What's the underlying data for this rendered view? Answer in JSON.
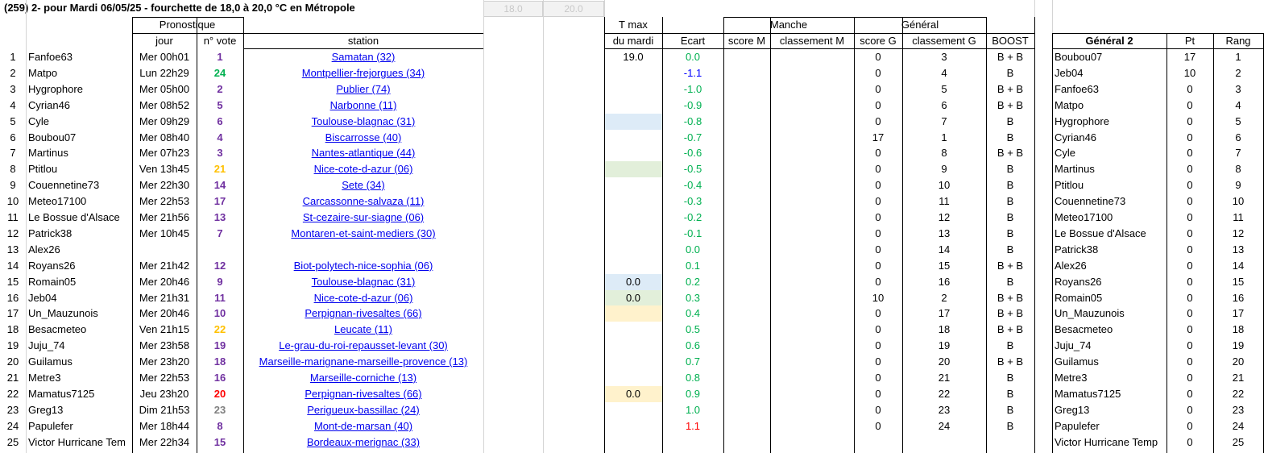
{
  "title": "(259) 2- pour Mardi 06/05/25 - fourchette de 18,0 à 20,0 °C en Métropole",
  "steppers": [
    "18.0",
    "20.0"
  ],
  "headers": {
    "pronostique": "Pronostique",
    "jour": "jour",
    "nvote": "n° vote",
    "station": "station",
    "tmax1": "T max",
    "tmax2": "du mardi",
    "ecart": "Ecart",
    "manche": "Manche",
    "scoreM": "score M",
    "classementM": "classement M",
    "general": "Général",
    "scoreG": "score G",
    "classementG": "classement G",
    "boost": "BOOST",
    "general2": "Général 2",
    "pt": "Pt",
    "rang": "Rang"
  },
  "colors": {
    "vote_purple": "#7030a0",
    "vote_green": "#00b050",
    "vote_orange": "#ffc000",
    "vote_red": "#ff0000",
    "vote_gray": "#808080",
    "ecart_green": "#00b050",
    "ecart_blue": "#0000ff",
    "ecart_red": "#ff0000",
    "fill_blue": "#ddebf7",
    "fill_green": "#e2efda",
    "fill_orange": "#fff2cc"
  },
  "rows": [
    {
      "n": "1",
      "name": "Fanfoe63",
      "jour": "Mer 00h01",
      "vote": "1",
      "vc": "vote_purple",
      "station": "Samatan (32)",
      "tmax": "19.0",
      "fill": "",
      "ecart": "0.0",
      "ec": "ecart_green",
      "scoreG": "0",
      "classG": "3",
      "boost": "B + B",
      "g2": "Boubou07",
      "pt": "17",
      "rang": "1"
    },
    {
      "n": "2",
      "name": "Matpo",
      "jour": "Lun 22h29",
      "vote": "24",
      "vc": "vote_green",
      "station": "Montpellier-frejorgues (34)",
      "tmax": "",
      "fill": "",
      "ecart": "-1.1",
      "ec": "ecart_blue",
      "scoreG": "0",
      "classG": "4",
      "boost": "B",
      "g2": "Jeb04",
      "pt": "10",
      "rang": "2"
    },
    {
      "n": "3",
      "name": "Hygrophore",
      "jour": "Mer 05h00",
      "vote": "2",
      "vc": "vote_purple",
      "station": "Publier (74)",
      "tmax": "",
      "fill": "",
      "ecart": "-1.0",
      "ec": "ecart_green",
      "scoreG": "0",
      "classG": "5",
      "boost": "B + B",
      "g2": "Fanfoe63",
      "pt": "0",
      "rang": "3"
    },
    {
      "n": "4",
      "name": "Cyrian46",
      "jour": "Mer 08h52",
      "vote": "5",
      "vc": "vote_purple",
      "station": "Narbonne (11)",
      "tmax": "",
      "fill": "",
      "ecart": "-0.9",
      "ec": "ecart_green",
      "scoreG": "0",
      "classG": "6",
      "boost": "B + B",
      "g2": "Matpo",
      "pt": "0",
      "rang": "4"
    },
    {
      "n": "5",
      "name": "Cyle",
      "jour": "Mer 09h29",
      "vote": "6",
      "vc": "vote_purple",
      "station": "Toulouse-blagnac (31)",
      "tmax": "",
      "fill": "fill_blue",
      "ecart": "-0.8",
      "ec": "ecart_green",
      "scoreG": "0",
      "classG": "7",
      "boost": "B",
      "g2": "Hygrophore",
      "pt": "0",
      "rang": "5"
    },
    {
      "n": "6",
      "name": "Boubou07",
      "jour": "Mer 08h40",
      "vote": "4",
      "vc": "vote_purple",
      "station": "Biscarrosse (40)",
      "tmax": "",
      "fill": "",
      "ecart": "-0.7",
      "ec": "ecart_green",
      "scoreG": "17",
      "classG": "1",
      "boost": "B",
      "g2": "Cyrian46",
      "pt": "0",
      "rang": "6"
    },
    {
      "n": "7",
      "name": "Martinus",
      "jour": "Mer 07h23",
      "vote": "3",
      "vc": "vote_purple",
      "station": "Nantes-atlantique (44)",
      "tmax": "",
      "fill": "",
      "ecart": "-0.6",
      "ec": "ecart_green",
      "scoreG": "0",
      "classG": "8",
      "boost": "B + B",
      "g2": "Cyle",
      "pt": "0",
      "rang": "7"
    },
    {
      "n": "8",
      "name": "Ptitlou",
      "jour": "Ven 13h45",
      "vote": "21",
      "vc": "vote_orange",
      "station": "Nice-cote-d-azur (06)",
      "tmax": "",
      "fill": "fill_green",
      "ecart": "-0.5",
      "ec": "ecart_green",
      "scoreG": "0",
      "classG": "9",
      "boost": "B",
      "g2": "Martinus",
      "pt": "0",
      "rang": "8"
    },
    {
      "n": "9",
      "name": "Couennetine73",
      "jour": "Mer 22h30",
      "vote": "14",
      "vc": "vote_purple",
      "station": "Sete (34)",
      "tmax": "",
      "fill": "",
      "ecart": "-0.4",
      "ec": "ecart_green",
      "scoreG": "0",
      "classG": "10",
      "boost": "B",
      "g2": "Ptitlou",
      "pt": "0",
      "rang": "9"
    },
    {
      "n": "10",
      "name": "Meteo17100",
      "jour": "Mer 22h53",
      "vote": "17",
      "vc": "vote_purple",
      "station": "Carcassonne-salvaza (11)",
      "tmax": "",
      "fill": "",
      "ecart": "-0.3",
      "ec": "ecart_green",
      "scoreG": "0",
      "classG": "11",
      "boost": "B",
      "g2": "Couennetine73",
      "pt": "0",
      "rang": "10"
    },
    {
      "n": "11",
      "name": "Le Bossue d'Alsace",
      "jour": "Mer 21h56",
      "vote": "13",
      "vc": "vote_purple",
      "station": "St-cezaire-sur-siagne (06)",
      "tmax": "",
      "fill": "",
      "ecart": "-0.2",
      "ec": "ecart_green",
      "scoreG": "0",
      "classG": "12",
      "boost": "B",
      "g2": "Meteo17100",
      "pt": "0",
      "rang": "11"
    },
    {
      "n": "12",
      "name": "Patrick38",
      "jour": "Mer 10h45",
      "vote": "7",
      "vc": "vote_purple",
      "station": "Montaren-et-saint-mediers (30)",
      "tmax": "",
      "fill": "",
      "ecart": "-0.1",
      "ec": "ecart_green",
      "scoreG": "0",
      "classG": "13",
      "boost": "B",
      "g2": "Le Bossue d'Alsace",
      "pt": "0",
      "rang": "12"
    },
    {
      "n": "13",
      "name": "Alex26",
      "jour": "",
      "vote": "",
      "vc": "vote_purple",
      "station": "",
      "tmax": "",
      "fill": "",
      "ecart": "0.0",
      "ec": "ecart_green",
      "scoreG": "0",
      "classG": "14",
      "boost": "B",
      "g2": "Patrick38",
      "pt": "0",
      "rang": "13"
    },
    {
      "n": "14",
      "name": "Royans26",
      "jour": "Mer 21h42",
      "vote": "12",
      "vc": "vote_purple",
      "station": "Biot-polytech-nice-sophia (06)",
      "tmax": "",
      "fill": "",
      "ecart": "0.1",
      "ec": "ecart_green",
      "scoreG": "0",
      "classG": "15",
      "boost": "B + B",
      "g2": "Alex26",
      "pt": "0",
      "rang": "14"
    },
    {
      "n": "15",
      "name": "Romain05",
      "jour": "Mer 20h46",
      "vote": "9",
      "vc": "vote_purple",
      "station": "Toulouse-blagnac (31)",
      "tmax": "0.0",
      "fill": "fill_blue",
      "ecart": "0.2",
      "ec": "ecart_green",
      "scoreG": "0",
      "classG": "16",
      "boost": "B",
      "g2": "Royans26",
      "pt": "0",
      "rang": "15"
    },
    {
      "n": "16",
      "name": "Jeb04",
      "jour": "Mer 21h31",
      "vote": "11",
      "vc": "vote_purple",
      "station": "Nice-cote-d-azur (06)",
      "tmax": "0.0",
      "fill": "fill_green",
      "ecart": "0.3",
      "ec": "ecart_green",
      "scoreG": "10",
      "classG": "2",
      "boost": "B + B",
      "g2": "Romain05",
      "pt": "0",
      "rang": "16"
    },
    {
      "n": "17",
      "name": "Un_Mauzunois",
      "jour": "Mer 20h46",
      "vote": "10",
      "vc": "vote_purple",
      "station": "Perpignan-rivesaltes (66)",
      "tmax": "",
      "fill": "fill_orange",
      "ecart": "0.4",
      "ec": "ecart_green",
      "scoreG": "0",
      "classG": "17",
      "boost": "B + B",
      "g2": "Un_Mauzunois",
      "pt": "0",
      "rang": "17"
    },
    {
      "n": "18",
      "name": "Besacmeteo",
      "jour": "Ven 21h15",
      "vote": "22",
      "vc": "vote_orange",
      "station": "Leucate (11)",
      "tmax": "",
      "fill": "",
      "ecart": "0.5",
      "ec": "ecart_green",
      "scoreG": "0",
      "classG": "18",
      "boost": "B + B",
      "g2": "Besacmeteo",
      "pt": "0",
      "rang": "18"
    },
    {
      "n": "19",
      "name": "Juju_74",
      "jour": "Mer 23h58",
      "vote": "19",
      "vc": "vote_purple",
      "station": "Le-grau-du-roi-repausset-levant (30)",
      "tmax": "",
      "fill": "",
      "ecart": "0.6",
      "ec": "ecart_green",
      "scoreG": "0",
      "classG": "19",
      "boost": "B",
      "g2": "Juju_74",
      "pt": "0",
      "rang": "19"
    },
    {
      "n": "20",
      "name": "Guilamus",
      "jour": "Mer 23h20",
      "vote": "18",
      "vc": "vote_purple",
      "station": "Marseille-marignane-marseille-provence (13)",
      "tmax": "",
      "fill": "",
      "ecart": "0.7",
      "ec": "ecart_green",
      "scoreG": "0",
      "classG": "20",
      "boost": "B + B",
      "g2": "Guilamus",
      "pt": "0",
      "rang": "20"
    },
    {
      "n": "21",
      "name": "Metre3",
      "jour": "Mer 22h53",
      "vote": "16",
      "vc": "vote_purple",
      "station": "Marseille-corniche (13)",
      "tmax": "",
      "fill": "",
      "ecart": "0.8",
      "ec": "ecart_green",
      "scoreG": "0",
      "classG": "21",
      "boost": "B",
      "g2": "Metre3",
      "pt": "0",
      "rang": "21"
    },
    {
      "n": "22",
      "name": "Mamatus7125",
      "jour": "Jeu 23h20",
      "vote": "20",
      "vc": "vote_red",
      "station": "Perpignan-rivesaltes (66)",
      "tmax": "0.0",
      "fill": "fill_orange",
      "ecart": "0.9",
      "ec": "ecart_green",
      "scoreG": "0",
      "classG": "22",
      "boost": "B",
      "g2": "Mamatus7125",
      "pt": "0",
      "rang": "22"
    },
    {
      "n": "23",
      "name": "Greg13",
      "jour": "Dim 21h53",
      "vote": "23",
      "vc": "vote_gray",
      "station": "Perigueux-bassillac (24)",
      "tmax": "",
      "fill": "",
      "ecart": "1.0",
      "ec": "ecart_green",
      "scoreG": "0",
      "classG": "23",
      "boost": "B",
      "g2": "Greg13",
      "pt": "0",
      "rang": "23"
    },
    {
      "n": "24",
      "name": "Papulefer",
      "jour": "Mer 18h44",
      "vote": "8",
      "vc": "vote_purple",
      "station": "Mont-de-marsan (40)",
      "tmax": "",
      "fill": "",
      "ecart": "1.1",
      "ec": "ecart_red",
      "scoreG": "0",
      "classG": "24",
      "boost": "B",
      "g2": "Papulefer",
      "pt": "0",
      "rang": "24"
    },
    {
      "n": "25",
      "name": "Victor Hurricane Tem",
      "jour": "Mer 22h34",
      "vote": "15",
      "vc": "vote_purple",
      "station": "Bordeaux-merignac (33)",
      "tmax": "",
      "fill": "",
      "ecart": "",
      "ec": "ecart_green",
      "scoreG": "",
      "classG": "",
      "boost": "",
      "g2": "Victor Hurricane Temp",
      "pt": "0",
      "rang": "25"
    }
  ]
}
